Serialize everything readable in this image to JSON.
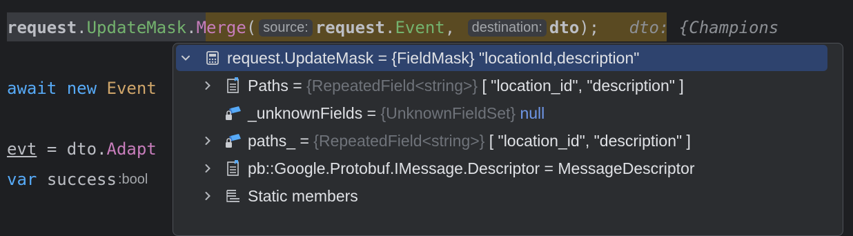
{
  "editor": {
    "line1": {
      "obj": "request",
      "dot1": ".",
      "prop": "UpdateMask",
      "dot2": ".",
      "method": "Merge",
      "paren_open": "(",
      "hint_source": "source:",
      "arg1_obj": "request",
      "arg1_dot": ".",
      "arg1_prop": "Event",
      "comma": ",",
      "hint_destination": "destination:",
      "arg2": "dto",
      "paren_close": ");",
      "inline_value": "dto: {Champions"
    },
    "line2": {
      "await": "await",
      "new": "new",
      "type_partial": "Event"
    },
    "line3": {
      "var": "evt",
      "eq": "=",
      "obj": "dto",
      "dot": ".",
      "method_partial": "Adapt"
    },
    "line4": {
      "var_kw": "var",
      "name": "success",
      "hint_type": ":bool"
    }
  },
  "debug_popup": {
    "root": {
      "chevron": "⌄",
      "icon": "watch-icon",
      "label": "request.UpdateMask = {FieldMask} \"locationId,description\""
    },
    "children": [
      {
        "name": "Paths",
        "eq": " = ",
        "type": "{RepeatedField<string>}",
        "value": " [ \"location_id\", \"description\" ]",
        "expandable": true,
        "icon": "property-icon"
      },
      {
        "name": "_unknownFields",
        "eq": " = ",
        "type": "{UnknownFieldSet}",
        "value": " null",
        "expandable": false,
        "icon": "private-field-icon"
      },
      {
        "name": "paths_",
        "eq": " = ",
        "type": "{RepeatedField<string>}",
        "value": " [ \"location_id\", \"description\" ]",
        "expandable": true,
        "icon": "private-field-icon"
      },
      {
        "name": "pb::Google.Protobuf.IMessage.Descriptor",
        "eq": " = ",
        "type": "",
        "value": "MessageDescriptor",
        "expandable": true,
        "icon": "property-icon"
      },
      {
        "name": "Static members",
        "eq": "",
        "type": "",
        "value": "",
        "expandable": true,
        "icon": "static-members-icon"
      }
    ]
  },
  "colors": {
    "background": "#1e1f22",
    "popup_bg": "#2b2d30",
    "selection": "#2e436e",
    "identifier": "#bcbec4",
    "method": "#57aaf7",
    "property": "#c77dbb",
    "keyword": "#cf8e6d",
    "value_null": "#6f97e8"
  }
}
